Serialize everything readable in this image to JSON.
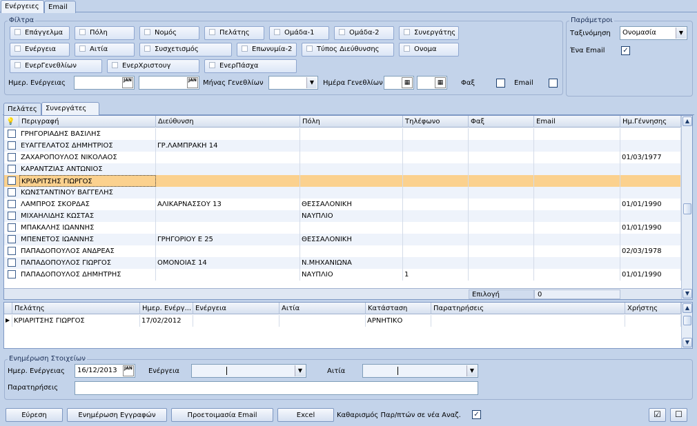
{
  "tabs": [
    {
      "label": "Ενέργειες"
    },
    {
      "label": "Email"
    }
  ],
  "filters": {
    "title": "Φίλτρα",
    "chips": [
      "Επάγγελμα",
      "Πόλη",
      "Νομός",
      "Πελάτης",
      "Ομάδα-1",
      "Ομάδα-2",
      "Συνεργάτης",
      "Ενέργεια",
      "Αιτία",
      "Συσχετισμός",
      "Επωνυμία-2",
      "Τύπος Διεύθυνσης",
      "Ονομα",
      "ΕνερΓενεθλίων",
      "ΕνερΧριστουγ",
      "ΕνερΠάσχα"
    ],
    "date_label": "Ημερ. Ενέργειας",
    "cal_icon": "JAN",
    "month_label": "Μήνας Γενεθλίων",
    "day_label": "Ημέρα Γενεθλίων",
    "fax_label": "Φαξ",
    "email_label": "Email"
  },
  "params": {
    "title": "Παράμετροι",
    "sort_label": "Ταξινόμηση",
    "sort_value": "Ονομασία",
    "one_email_label": "Ένα Email",
    "one_email_checked": "✓"
  },
  "subtabs": [
    {
      "label": "Πελάτες"
    },
    {
      "label": "Συνεργάτες"
    }
  ],
  "grid": {
    "headers": [
      "Περιγραφή",
      "Διεύθυνση",
      "Πόλη",
      "Τηλέφωνο",
      "Φαξ",
      "Email",
      "Ημ.Γέννησης"
    ],
    "rows": [
      [
        "ΓΡΗΓΟΡΙΑΔΗΣ ΒΑΣΙΛΗΣ",
        "",
        "",
        "",
        "",
        "",
        ""
      ],
      [
        "ΕΥΑΓΓΕΛΑΤΟΣ ΔΗΜΗΤΡΙΟΣ",
        "ΓΡ.ΛΑΜΠΡΑΚΗ 14",
        "",
        "",
        "",
        "",
        ""
      ],
      [
        "ΖΑΧΑΡΟΠΟΥΛΟΣ ΝΙΚΟΛΑΟΣ",
        "",
        "",
        "",
        "",
        "",
        "01/03/1977"
      ],
      [
        "ΚΑΡΑΝΤΖΙΑΣ ΑΝΤΩΝΙΟΣ",
        "",
        "",
        "",
        "",
        "",
        ""
      ],
      [
        "ΚΡΙΑΡΙΤΣΗΣ ΓΙΩΡΓΟΣ",
        "",
        "",
        "",
        "",
        "",
        ""
      ],
      [
        "ΚΩΝΣΤΑΝΤΙΝΟΥ ΒΑΓΓΕΛΗΣ",
        "",
        "",
        "",
        "",
        "",
        ""
      ],
      [
        "ΛΑΜΠΡΟΣ ΣΚΟΡΔΑΣ",
        "ΑΛΙΚΑΡΝΑΣΣΟΥ 13",
        "ΘΕΣΣΑΛΟΝΙΚΗ",
        "",
        "",
        "",
        "01/01/1990"
      ],
      [
        "ΜΙΧΑΗΛΙΔΗΣ ΚΩΣΤΑΣ",
        "",
        "ΝΑΥΠΛΙΟ",
        "",
        "",
        "",
        ""
      ],
      [
        "ΜΠΑΚΑΛΗΣ ΙΩΑΝΝΗΣ",
        "",
        "",
        "",
        "",
        "",
        "01/01/1990"
      ],
      [
        "ΜΠΕΝΕΤΟΣ ΙΩΑΝΝΗΣ",
        "ΓΡΗΓΟΡΙΟΥ Ε 25",
        "ΘΕΣΣΑΛΟΝΙΚΗ",
        "",
        "",
        "",
        ""
      ],
      [
        "ΠΑΠΑΔΟΠΟΥΛΟΣ ΑΝΔΡΕΑΣ",
        "",
        "",
        "",
        "",
        "",
        "02/03/1978"
      ],
      [
        "ΠΑΠΑΔΟΠΟΥΛΟΣ ΓΙΩΡΓΟΣ",
        "ΟΜΟΝΟΙΑΣ 14",
        "Ν.ΜΗΧΑΝΙΩΝΑ",
        "",
        "",
        "",
        ""
      ],
      [
        "ΠΑΠΑΔΟΠΟΥΛΟΣ ΔΗΜΗΤΡΗΣ",
        "",
        "ΝΑΥΠΛΙΟ",
        "1",
        "",
        "",
        "01/01/1990"
      ]
    ],
    "footer_label": "Επιλογή",
    "footer_value": "0",
    "scroll_up": "▲",
    "scroll_down": "▼"
  },
  "actions_grid": {
    "headers": [
      "Πελάτης",
      "Ημερ. Ενέργ...",
      "Ενέργεια",
      "Αιτία",
      "Κατάσταση",
      "Παρατηρήσεις",
      "Χρήστης"
    ],
    "rows": [
      [
        "ΚΡΙΑΡΙΤΣΗΣ ΓΙΩΡΓΟΣ",
        "17/02/2012",
        "",
        "",
        "ΑΡΝΗΤΙΚΟ",
        "",
        ""
      ]
    ],
    "row_pointer": "▶"
  },
  "update": {
    "title": "Ενημέρωση Στοιχείων",
    "date_label": "Ημερ. Ενέργειας",
    "date_value": "16/12/2013",
    "action_label": "Ενέργεια",
    "reason_label": "Αιτία",
    "notes_label": "Παρατηρήσεις"
  },
  "bottom": {
    "search": "Εύρεση",
    "update_records": "Ενημέρωση Εγγραφών",
    "prepare_email": "Προετοιμασία Email",
    "excel": "Excel",
    "clear_label": "Καθαρισμός Παρ/πτών σε νέα Αναζ.",
    "clear_checked": "✓",
    "check_all_icon": "☑",
    "uncheck_all_icon": "☐"
  }
}
